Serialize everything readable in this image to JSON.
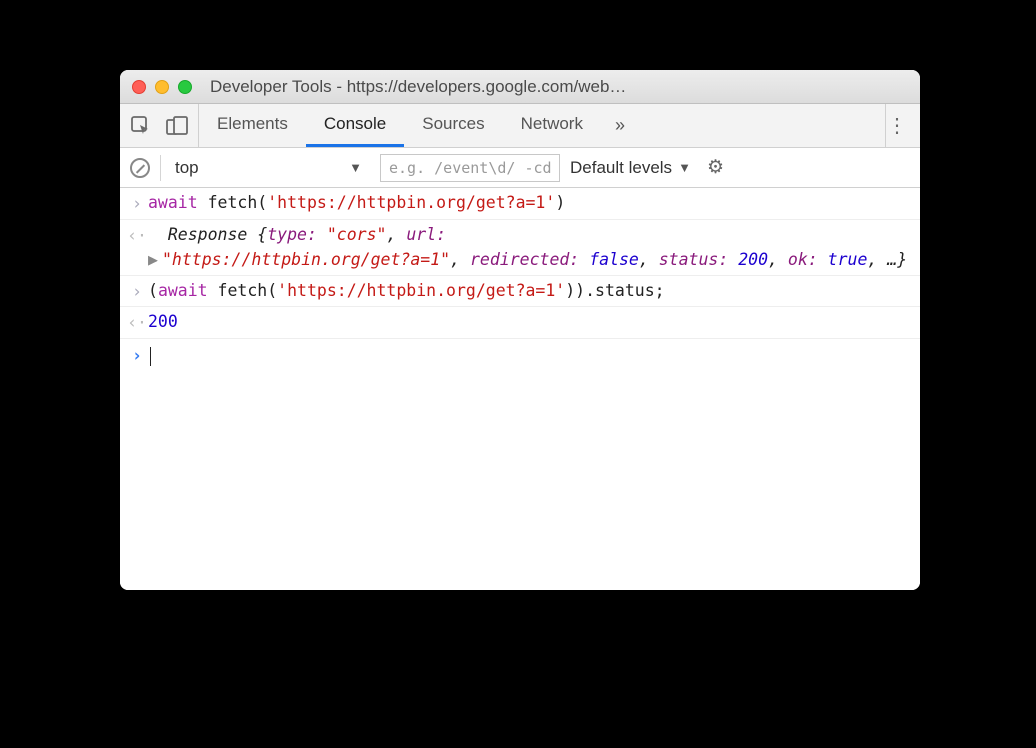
{
  "window": {
    "title": "Developer Tools - https://developers.google.com/web…"
  },
  "tabs": {
    "elements": "Elements",
    "console": "Console",
    "sources": "Sources",
    "network": "Network",
    "overflow": "»"
  },
  "toolbar": {
    "context": "top",
    "filter_placeholder": "e.g. /event\\d/ -cdn",
    "levels": "Default levels"
  },
  "console": {
    "line1": {
      "await": "await",
      "fetch": " fetch(",
      "url": "'https://httpbin.org/get?a=1'",
      "close": ")"
    },
    "line2": {
      "indent": "  ",
      "obj": "Response ",
      "open": "{",
      "p_type": "type: ",
      "v_type": "\"cors\"",
      "c1": ", ",
      "p_url": "url:",
      "br": " ",
      "v_url": "\"https://httpbin.org/get?a=1\"",
      "c2": ", ",
      "p_redir": "redirected: ",
      "v_redir": "false",
      "c3": ", ",
      "p_status": "status: ",
      "v_status": "200",
      "c4": ", ",
      "p_ok": "ok: ",
      "v_ok": "true",
      "tail": ", …}"
    },
    "line3": {
      "open": "(",
      "await": "await",
      "fetch": " fetch(",
      "url": "'https://httpbin.org/get?a=1'",
      "close": ")).status;"
    },
    "line4": {
      "value": "200"
    }
  }
}
